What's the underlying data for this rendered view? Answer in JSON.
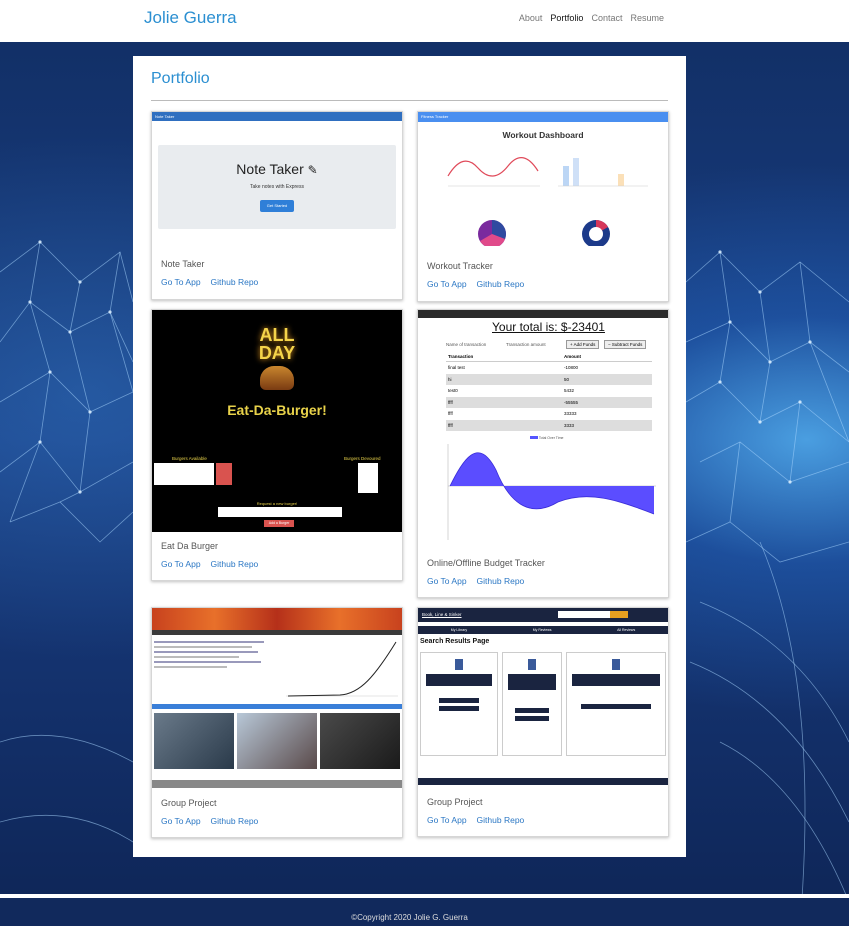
{
  "navbar": {
    "brand": "Jolie Guerra",
    "links": [
      {
        "label": "About",
        "active": false
      },
      {
        "label": "Portfolio",
        "active": true
      },
      {
        "label": "Contact",
        "active": false
      },
      {
        "label": "Resume",
        "active": false
      }
    ]
  },
  "panel": {
    "title": "Portfolio"
  },
  "projects": [
    {
      "title": "Note Taker",
      "link_app": "Go To App",
      "link_repo": "Github Repo",
      "preview": {
        "bar_label": "Note Taker",
        "heading": "Note Taker",
        "subheading": "Take notes with Express",
        "button": "Get Started"
      }
    },
    {
      "title": "Workout Tracker",
      "link_app": "Go To App",
      "link_repo": "Github Repo",
      "preview": {
        "bar_label": "Fitness Tracker",
        "heading": "Workout Dashboard"
      }
    },
    {
      "title": "Eat Da Burger",
      "link_app": "Go To App",
      "link_repo": "Github Repo",
      "preview": {
        "sign_line1": "ALL",
        "sign_line2": "DAY",
        "heading": "Eat-Da-Burger!",
        "left_col": "Burgers Available",
        "right_col": "Burgers Devoured",
        "request_label": "Request a new burger!",
        "button": "Add a Burger"
      }
    },
    {
      "title": "Online/Offline Budget Tracker",
      "link_app": "Go To App",
      "link_repo": "Github Repo",
      "preview": {
        "total": "Your total is: $-23401",
        "add_funds": "+ Add Funds",
        "subtract_funds": "− Subtract Funds",
        "name_placeholder": "Name of transaction",
        "amount_placeholder": "Transaction amount",
        "col_transaction": "Transaction",
        "col_amount": "Amount",
        "rows": [
          {
            "name": "final test",
            "amount": "-10800"
          },
          {
            "name": "hi",
            "amount": "50"
          },
          {
            "name": "test0",
            "amount": "5432"
          },
          {
            "name": "ffff",
            "amount": "-55555"
          },
          {
            "name": "ffff",
            "amount": "33333"
          },
          {
            "name": "ffff",
            "amount": "3333"
          }
        ],
        "legend": "Total Over Time"
      }
    },
    {
      "title": "Group Project",
      "link_app": "Go To App",
      "link_repo": "Github Repo",
      "preview": {}
    },
    {
      "title": "Group Project",
      "link_app": "Go To App",
      "link_repo": "Github Repo",
      "preview": {
        "brand": "Book, Line & Sinker",
        "heading": "Search Results Page",
        "tabs": [
          "My Library",
          "My Reviews",
          "All Reviews"
        ]
      }
    }
  ],
  "footer": {
    "text": "©Copyright 2020 Jolie G. Guerra"
  }
}
